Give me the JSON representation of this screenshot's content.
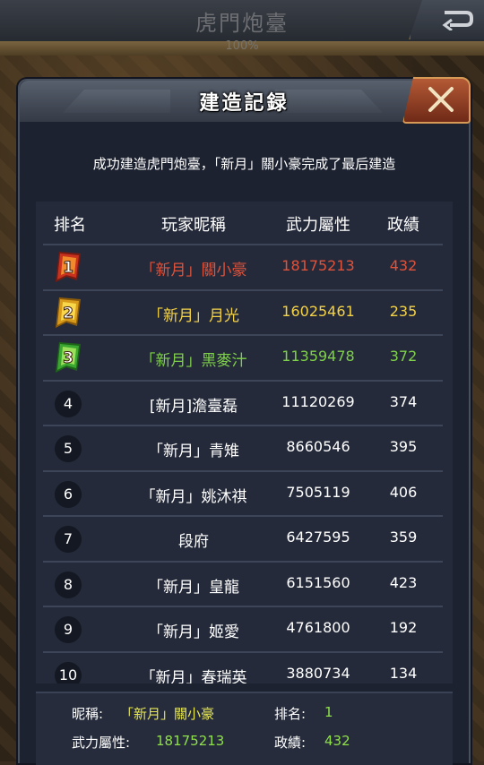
{
  "top_bar": {
    "title": "虎門炮臺",
    "progress_text": "100%",
    "progress": 1.0
  },
  "dialog": {
    "title": "建造記録",
    "message": "成功建造虎門炮臺，「新月」關小豪完成了最后建造",
    "columns": [
      "排名",
      "玩家昵稱",
      "武力屬性",
      "政績"
    ],
    "rows": [
      {
        "rank": "1",
        "name": "「新月」關小豪",
        "power": "18175213",
        "score": "432",
        "tier": "red"
      },
      {
        "rank": "2",
        "name": "「新月」月光",
        "power": "16025461",
        "score": "235",
        "tier": "gold"
      },
      {
        "rank": "3",
        "name": "「新月」黑麥汁",
        "power": "11359478",
        "score": "372",
        "tier": "green"
      },
      {
        "rank": "4",
        "name": "[新月]澹臺磊",
        "power": "11120269",
        "score": "374",
        "tier": ""
      },
      {
        "rank": "5",
        "name": "「新月」青雉",
        "power": "8660546",
        "score": "395",
        "tier": ""
      },
      {
        "rank": "6",
        "name": "「新月」姚沐祺",
        "power": "7505119",
        "score": "406",
        "tier": ""
      },
      {
        "rank": "7",
        "name": "段府",
        "power": "6427595",
        "score": "359",
        "tier": ""
      },
      {
        "rank": "8",
        "name": "「新月」皇龍",
        "power": "6151560",
        "score": "423",
        "tier": ""
      },
      {
        "rank": "9",
        "name": "「新月」姬愛",
        "power": "4761800",
        "score": "192",
        "tier": ""
      },
      {
        "rank": "10",
        "name": "「新月」春瑞英",
        "power": "3880734",
        "score": "134",
        "tier": ""
      }
    ],
    "footer": {
      "nickname_label": "昵稱:",
      "nickname": "「新月」關小豪",
      "rank_label": "排名:",
      "rank": "1",
      "power_label": "武力屬性:",
      "power": "18175213",
      "score_label": "政績:",
      "score": "432"
    }
  },
  "colors": {
    "first": "#e0523a",
    "second": "#f4d247",
    "third": "#7fd04a"
  },
  "icons": {
    "back": "back-arrow-icon",
    "close": "close-x-icon",
    "rank_badge": "rank-medal-icon"
  }
}
